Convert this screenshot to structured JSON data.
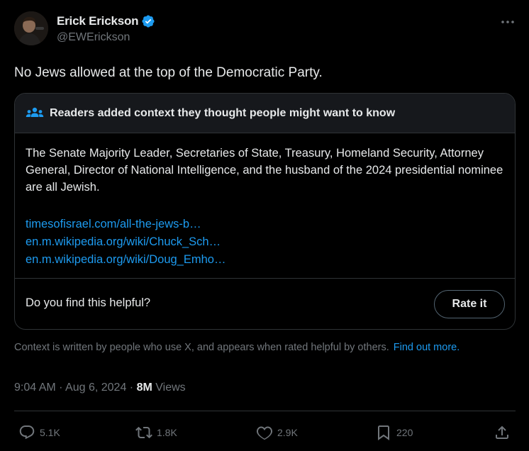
{
  "author": {
    "name": "Erick Erickson",
    "handle": "@EWErickson"
  },
  "tweet": {
    "text": "No Jews allowed at the top of the Democratic Party."
  },
  "note": {
    "title": "Readers added context they thought people might want to know",
    "body": "The Senate Majority Leader, Secretaries of State, Treasury, Homeland Security, Attorney General, Director of National Intelligence, and the husband of the 2024 presidential nominee are all Jewish.",
    "links": [
      "timesofisrael.com/all-the-jews-b…",
      "en.m.wikipedia.org/wiki/Chuck_Sch…",
      "en.m.wikipedia.org/wiki/Doug_Emho…"
    ],
    "helpful_question": "Do you find this helpful?",
    "rate_label": "Rate it"
  },
  "context": {
    "text": "Context is written by people who use X, and appears when rated helpful by others.",
    "find_out_more": "Find out more."
  },
  "meta": {
    "time": "9:04 AM",
    "date": "Aug 6, 2024",
    "separator": "·",
    "views_count": "8M",
    "views_label": "Views"
  },
  "actions": {
    "replies": "5.1K",
    "reposts": "1.8K",
    "likes": "2.9K",
    "bookmarks": "220"
  },
  "colors": {
    "background": "#000000",
    "text": "#e7e9ea",
    "muted": "#71767b",
    "link": "#1d9bf0",
    "verified": "#1d9bf0",
    "border": "#2f3336"
  },
  "icons": [
    "verified-badge-icon",
    "more-icon",
    "people-icon",
    "reply-icon",
    "repost-icon",
    "like-icon",
    "bookmark-icon",
    "share-icon"
  ]
}
